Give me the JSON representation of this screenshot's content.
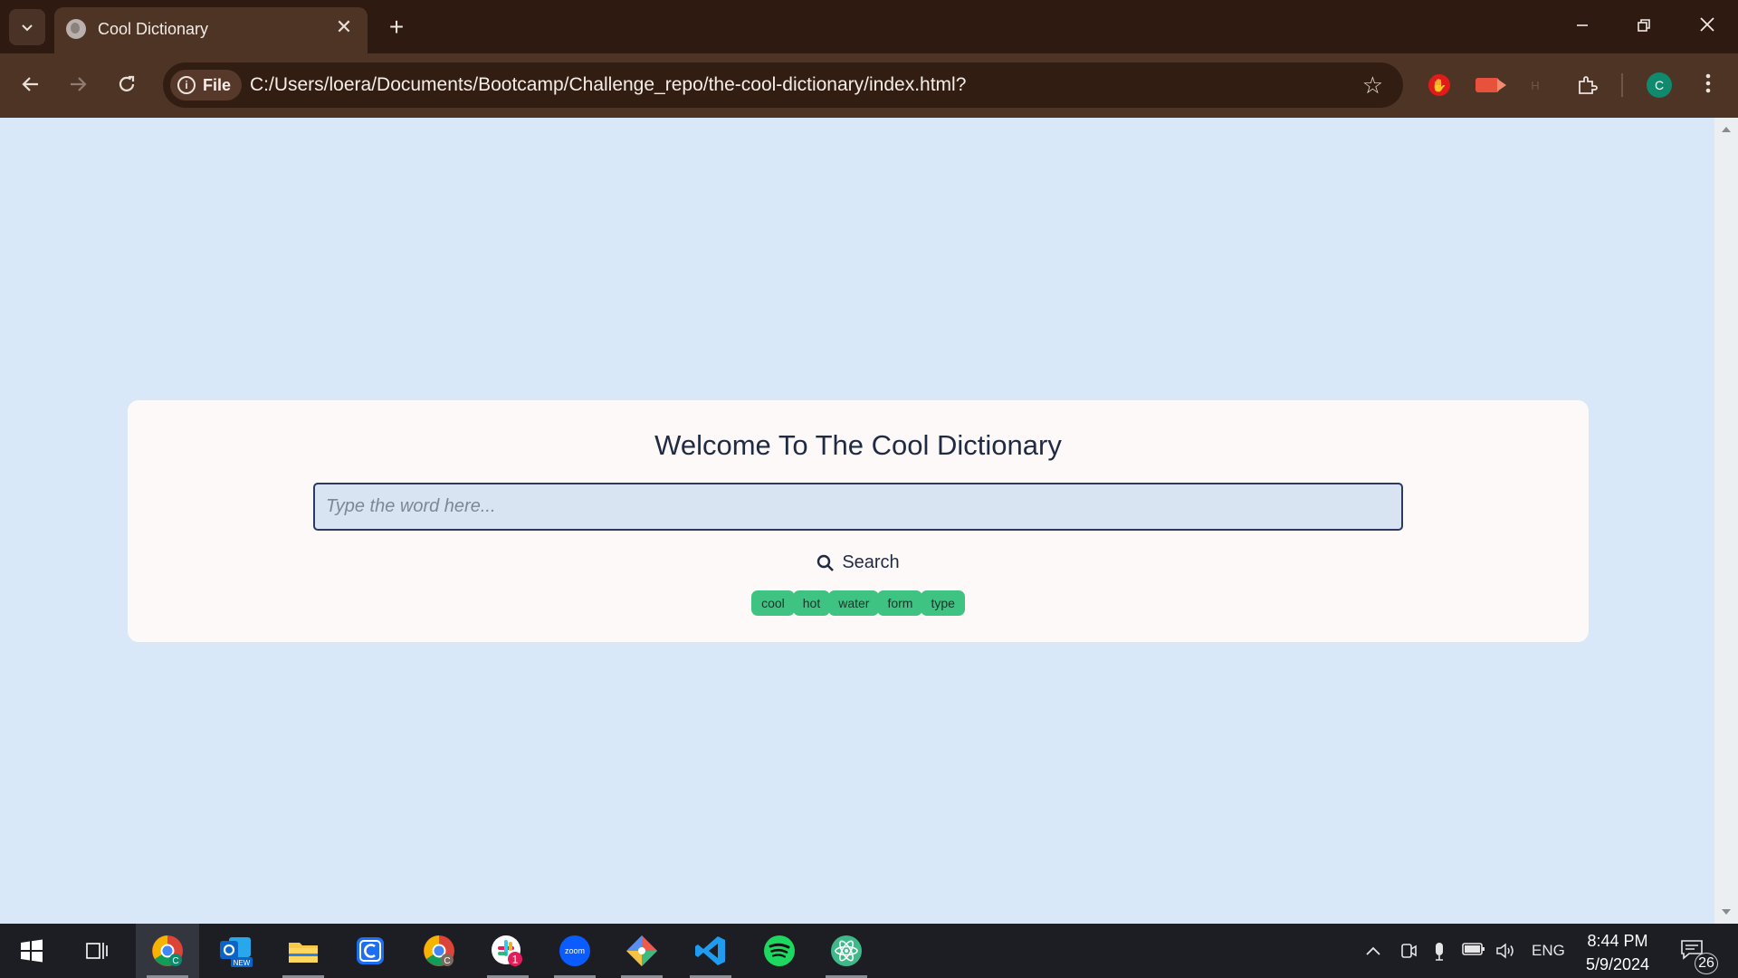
{
  "browser": {
    "tab_title": "Cool Dictionary",
    "tab_close_glyph": "✕",
    "new_tab_glyph": "+",
    "address_chip_label": "File",
    "address_url": "C:/Users/loera/Documents/Bootcamp/Challenge_repo/the-cool-dictionary/index.html?",
    "profile_initial": "C",
    "extension_dim_label": "H"
  },
  "page": {
    "heading": "Welcome To The Cool Dictionary",
    "search_placeholder": "Type the word here...",
    "search_button_label": "Search",
    "suggestion_tags": [
      "cool",
      "hot",
      "water",
      "form",
      "type"
    ]
  },
  "taskbar": {
    "apps": [
      "windows-start",
      "task-view",
      "chrome",
      "outlook-new",
      "file-explorer",
      "c-app",
      "chrome-profile",
      "slack",
      "zoom",
      "git",
      "vscode",
      "spotify",
      "atom"
    ],
    "slack_badge": "1",
    "zoom_label": "zoom",
    "outlook_badge": "NEW",
    "language": "ENG",
    "time": "8:44 PM",
    "date": "5/9/2024",
    "notification_count": "26"
  },
  "colors": {
    "page_background": "#d8e8f9",
    "card_background": "#fdf9f8",
    "tag_green": "#3fc383",
    "chrome_dark": "#2e1a10",
    "chrome_toolbar": "#4e3425"
  }
}
